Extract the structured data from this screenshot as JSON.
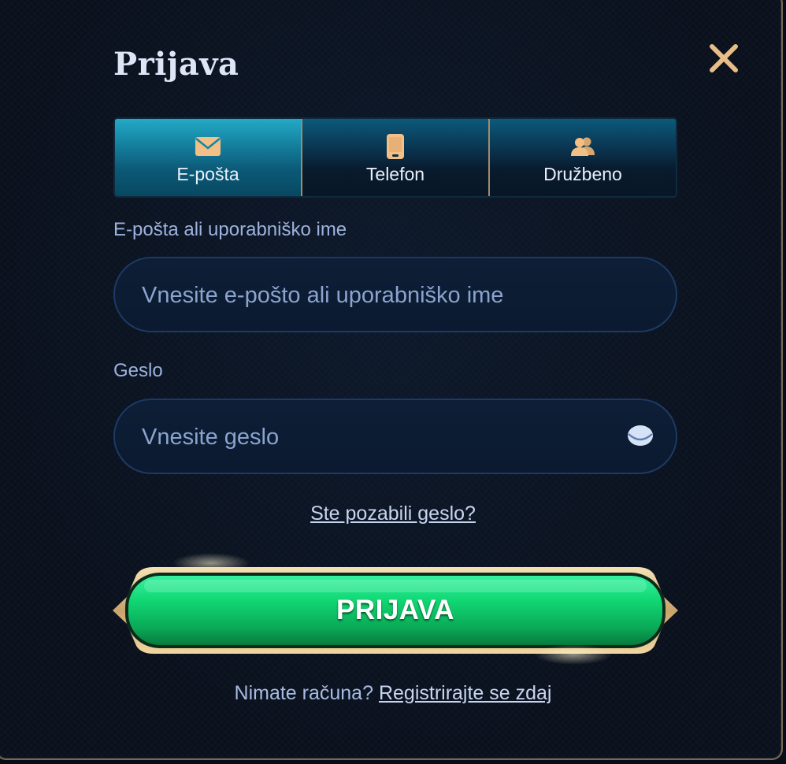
{
  "modal": {
    "title": "Prijava"
  },
  "tabs": [
    {
      "label": "E-pošta",
      "icon": "envelope-icon",
      "active": true
    },
    {
      "label": "Telefon",
      "icon": "phone-icon",
      "active": false
    },
    {
      "label": "Družbeno",
      "icon": "users-icon",
      "active": false
    }
  ],
  "email": {
    "label": "E-pošta ali uporabniško ime",
    "placeholder": "Vnesite e-pošto ali uporabniško ime",
    "value": ""
  },
  "password": {
    "label": "Geslo",
    "placeholder": "Vnesite geslo",
    "value": "",
    "toggle_icon": "eye-icon"
  },
  "forgot_link": "Ste pozabili geslo?",
  "submit_label": "PRIJAVA",
  "register": {
    "prompt": "Nimate računa?",
    "link": "Registrirajte se zdaj"
  },
  "colors": {
    "background": "#0a111d",
    "accent_gold": "#e7bd88",
    "tab_active": "#1685a3",
    "button_green": "#10d06a",
    "label": "#9db2dd"
  }
}
